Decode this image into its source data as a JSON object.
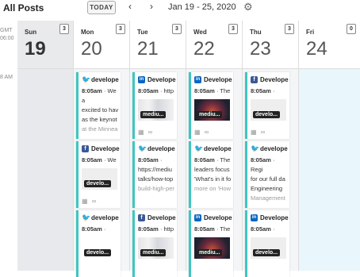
{
  "header": {
    "title": "All Posts",
    "today_label": "TODAY",
    "prev_icon": "‹",
    "next_icon": "›",
    "date_range": "Jan 19 - 25, 2020",
    "settings_icon": "⚙"
  },
  "gutter": {
    "tz": "GMT\n06:00",
    "tz1": "GMT",
    "tz2": "06:00",
    "time_label": "8 AM"
  },
  "days": [
    {
      "name": "Sun",
      "num": "19",
      "count": "3"
    },
    {
      "name": "Mon",
      "num": "20",
      "count": "3"
    },
    {
      "name": "Tue",
      "num": "21",
      "count": "3"
    },
    {
      "name": "Wed",
      "num": "22",
      "count": "3"
    },
    {
      "name": "Thu",
      "num": "23",
      "count": "3"
    },
    {
      "name": "Fri",
      "num": "24",
      "count": "0"
    }
  ],
  "cards": {
    "mon_1": {
      "net": "twitter",
      "name": "develope",
      "time": "8:05am",
      "l1": " · We a",
      "l2": "excited to hav",
      "l3": "as the keynot",
      "l4": "at the Minnea"
    },
    "mon_2": {
      "net": "facebook",
      "name": "Develope",
      "time": "8:05am",
      "l1": " · We",
      "tag": "develo..."
    },
    "mon_3": {
      "net": "twitter",
      "name": "develope",
      "time": "8:05am",
      "l1": " ·",
      "l2": "",
      "tag": "develo..."
    },
    "tue_1": {
      "net": "linkedin",
      "name": "Develope",
      "time": "8:05am",
      "l1": " · http",
      "tag": "mediu..."
    },
    "tue_2": {
      "net": "twitter",
      "name": "develope",
      "time": "8:05am",
      "l1": " ·",
      "l2": "https://mediu",
      "l3": "talks/how-top",
      "l4": "build-high-per"
    },
    "tue_3": {
      "net": "facebook",
      "name": "Develope",
      "time": "8:05am",
      "l1": " · http",
      "tag": "mediu..."
    },
    "wed_1": {
      "net": "linkedin",
      "name": "Develope",
      "time": "8:05am",
      "l1": " · The",
      "tag": "mediu..."
    },
    "wed_2": {
      "net": "twitter",
      "name": "develope",
      "time": "8:05am",
      "l1": " · The",
      "l2": "leaders focus",
      "l3": "'What's in it fo",
      "l4": "more on 'How"
    },
    "wed_3": {
      "net": "linkedin",
      "name": "Develope",
      "time": "8:05am",
      "l1": " · The",
      "tag": "mediu..."
    },
    "thu_1": {
      "net": "facebook",
      "name": "Develope",
      "time": "8:05am",
      "l1": " ·",
      "tag": "develo..."
    },
    "thu_2": {
      "net": "twitter",
      "name": "develope",
      "time": "8:05am",
      "l1": " · Regi",
      "l2": "for our full da",
      "l3": "Engineering",
      "l4": "Management"
    },
    "thu_3": {
      "net": "linkedin",
      "name": "Develope",
      "time": "8:05am",
      "l1": " ·",
      "tag": "develo..."
    }
  },
  "icons": {
    "calendar": "calendar-icon",
    "link": "link-icon",
    "twitter": "twitter-icon",
    "facebook": "facebook-icon",
    "linkedin": "linkedin-icon"
  },
  "colors": {
    "accent": "#3ec6c1",
    "twitter": "#1da1f2",
    "facebook": "#3b5998",
    "linkedin": "#0a66c2"
  }
}
